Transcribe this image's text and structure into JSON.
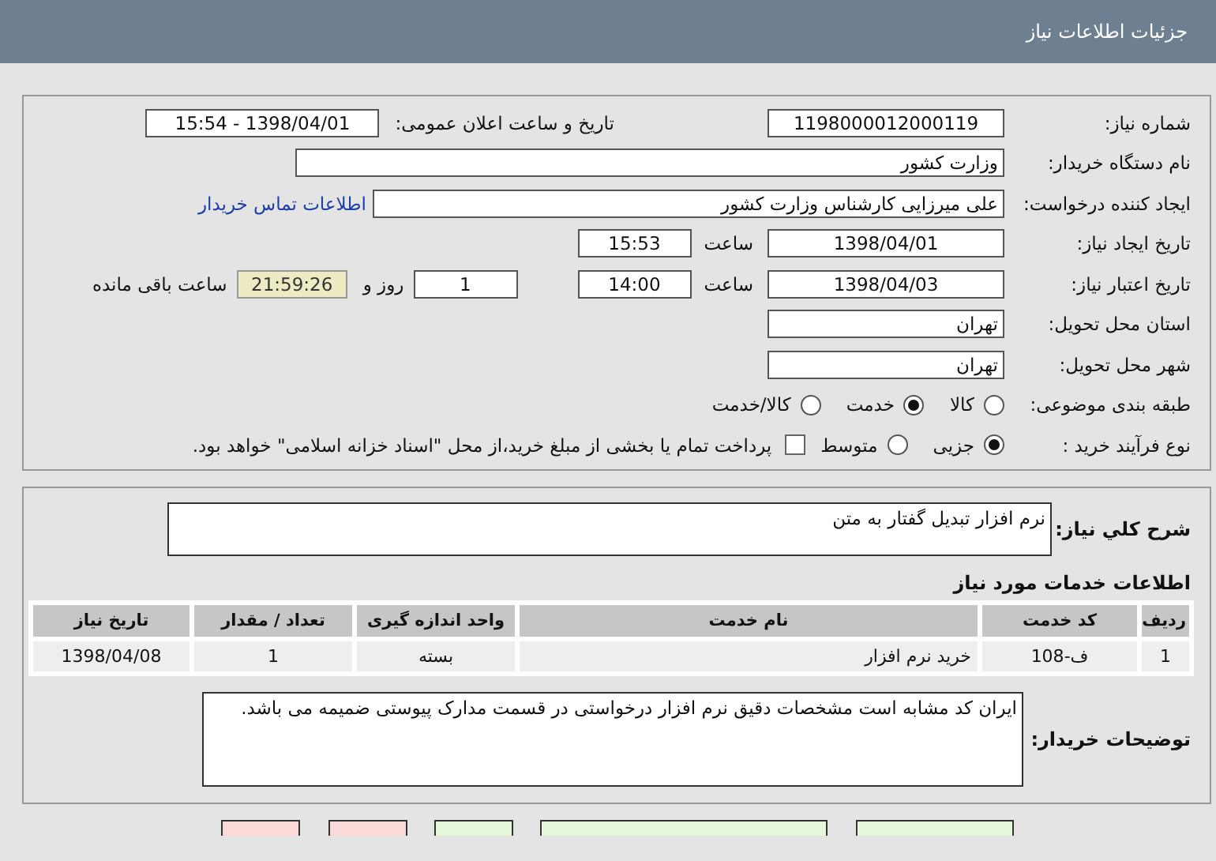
{
  "header": {
    "title": "جزئیات اطلاعات نیاز"
  },
  "details": [
    {
      "label": "شماره نیاز:",
      "items": [
        {
          "kind": "field",
          "value": "1198000012000119"
        },
        {
          "kind": "text",
          "value": "تاریخ و ساعت اعلان عمومی:"
        },
        {
          "kind": "field",
          "value": "1398/04/01 - 15:54"
        }
      ]
    },
    {
      "label": "نام دستگاه خریدار:",
      "items": [
        {
          "kind": "field",
          "value": "وزارت کشور"
        }
      ]
    },
    {
      "label": "ایجاد کننده درخواست:",
      "items": [
        {
          "kind": "field",
          "value": "علی میرزایی کارشناس وزارت کشور"
        },
        {
          "kind": "link",
          "value": "اطلاعات تماس خریدار"
        }
      ]
    },
    {
      "label": "تاریخ ایجاد نیاز:",
      "items": [
        {
          "kind": "field",
          "value": "1398/04/01"
        },
        {
          "kind": "text",
          "value": "ساعت"
        },
        {
          "kind": "field",
          "value": "15:53"
        }
      ]
    },
    {
      "label": "تاریخ اعتبار نیاز:",
      "items": [
        {
          "kind": "field",
          "value": "1398/04/03"
        },
        {
          "kind": "text",
          "value": "ساعت"
        },
        {
          "kind": "field",
          "value": "14:00"
        },
        {
          "kind": "field",
          "value": "1"
        },
        {
          "kind": "text",
          "value": "روز و"
        },
        {
          "kind": "countdown",
          "value": "21:59:26"
        },
        {
          "kind": "text",
          "value": "ساعت باقی مانده"
        }
      ]
    },
    {
      "label": "استان محل تحویل:",
      "items": [
        {
          "kind": "field",
          "value": "تهران"
        }
      ]
    },
    {
      "label": "شهر محل تحویل:",
      "items": [
        {
          "kind": "field",
          "value": "تهران"
        }
      ]
    },
    {
      "label": "طبقه بندی موضوعی:",
      "items": [
        {
          "kind": "radio",
          "value": "کالا",
          "selected": false
        },
        {
          "kind": "radio",
          "value": "خدمت",
          "selected": true
        },
        {
          "kind": "radio",
          "value": "کالا/خدمت",
          "selected": false
        }
      ]
    },
    {
      "label": "نوع فرآیند خرید :",
      "items": [
        {
          "kind": "radio",
          "value": "جزیی",
          "selected": true
        },
        {
          "kind": "radio",
          "value": "متوسط",
          "selected": false
        },
        {
          "kind": "checkbox",
          "value": "پرداخت تمام یا بخشی از مبلغ خرید،از محل \"اسناد خزانه اسلامی\" خواهد بود.",
          "checked": false
        }
      ]
    }
  ],
  "summary": {
    "label": "شرح کلي نیاز:",
    "value": "نرم افزار تبدیل گفتار به متن"
  },
  "services": {
    "title": "اطلاعات خدمات مورد نیاز",
    "columns": [
      "ردیف",
      "کد خدمت",
      "نام خدمت",
      "واحد اندازه گیری",
      "تعداد / مقدار",
      "تاریخ نیاز"
    ],
    "rows": [
      [
        "1",
        "ف-108",
        "خرید نرم افزار",
        "بسته",
        "1",
        "1398/04/08"
      ]
    ]
  },
  "buyer_notes": {
    "label": "توضیحات خریدار:",
    "value": "ایران کد مشابه است مشخصات دقیق نرم افزار درخواستی در قسمت مدارک پیوستی ضمیمه می باشد."
  },
  "buttons": [
    {
      "color": "#e6f8dc"
    },
    {
      "color": "#e6f8dc"
    },
    {
      "color": "#e6f8dc"
    },
    {
      "color": "#fcd9d9"
    },
    {
      "color": "#fcd9d9"
    }
  ]
}
